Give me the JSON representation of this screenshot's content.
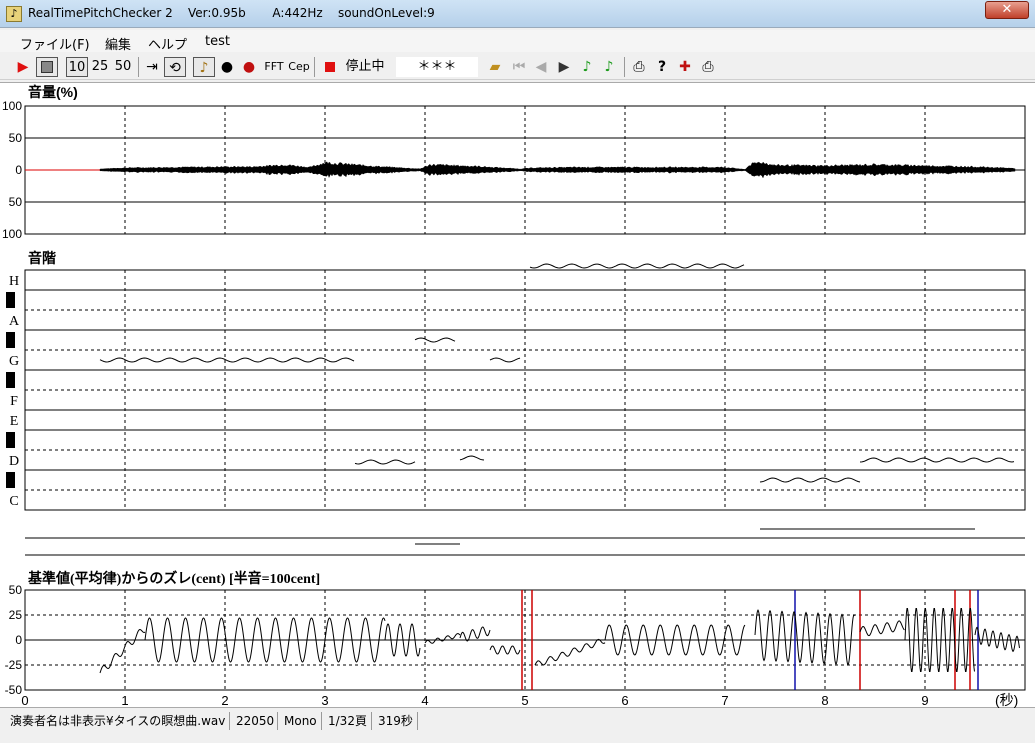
{
  "window": {
    "title": "RealTimePitchChecker 2    Ver:0.95b       A:442Hz    soundOnLevel:9",
    "close_label": "✕"
  },
  "menu": [
    "ファイル(F)",
    "編集",
    "ヘルプ",
    "test"
  ],
  "toolbar": {
    "play_icon": "play-icon",
    "stop_icon": "stop-icon",
    "zoom_options": [
      "10",
      "25",
      "50"
    ],
    "fft_label": "FFT",
    "cep_label": "Cep",
    "status_text": "停止中",
    "display_text": "＊＊＊",
    "colors": {
      "play": "#e01010",
      "stop_state": "#e01010",
      "note_green": "#1a9a1a"
    }
  },
  "panels": {
    "volume": {
      "title": "音量(%)",
      "yticks": [
        "100",
        "50",
        "0",
        "50",
        "100"
      ]
    },
    "scale": {
      "title": "音階",
      "notes": [
        "H",
        "A",
        "G",
        "F",
        "E",
        "D",
        "C"
      ]
    },
    "cents": {
      "title": "基準値(平均律)からのズレ(cent) [半音=100cent]",
      "yticks": [
        "50",
        "25",
        "0",
        "-25",
        "-50"
      ]
    }
  },
  "chart_data": {
    "type": "line",
    "x_axis": {
      "ticks": [
        "0",
        "1",
        "2",
        "3",
        "4",
        "5",
        "6",
        "7",
        "8",
        "9"
      ],
      "unit_label": "(秒)",
      "xlim": [
        0,
        10
      ]
    },
    "volume": {
      "type": "area",
      "ylim": [
        -100,
        100
      ],
      "x": [
        0.75,
        1.0,
        1.5,
        2.0,
        2.3,
        2.6,
        2.85,
        3.0,
        3.5,
        3.95,
        4.05,
        4.5,
        4.95,
        5.1,
        5.5,
        6.0,
        6.5,
        7.0,
        7.2,
        7.25,
        7.35,
        7.5,
        8.0,
        8.5,
        9.0,
        9.5,
        9.9
      ],
      "amplitude": [
        2,
        4,
        5,
        6,
        6,
        10,
        5,
        14,
        7,
        2,
        10,
        7,
        2,
        4,
        5,
        5,
        5,
        5,
        1,
        10,
        15,
        9,
        8,
        10,
        8,
        6,
        3
      ]
    },
    "pitch_segments": [
      {
        "x": [
          0.75,
          3.3
        ],
        "note_level": 7.5
      },
      {
        "x": [
          3.3,
          3.9
        ],
        "note_level": 2.4
      },
      {
        "x": [
          3.9,
          4.3
        ],
        "note_level": 8.5
      },
      {
        "x": [
          4.35,
          4.6
        ],
        "note_level": 2.6
      },
      {
        "x": [
          4.65,
          4.95
        ],
        "note_level": 7.5
      },
      {
        "x": [
          5.05,
          7.2
        ],
        "note_level": 12.2
      },
      {
        "x": [
          7.35,
          8.35
        ],
        "note_level": 1.5
      },
      {
        "x": [
          8.35,
          9.9
        ],
        "note_level": 2.5
      }
    ],
    "cents": {
      "ylim": [
        -50,
        50
      ],
      "segments": [
        {
          "x_start": 0.75,
          "x_end": 1.2,
          "y_start": -33,
          "y_end": 12,
          "amp": 4,
          "period": 0.12
        },
        {
          "x_start": 1.2,
          "x_end": 3.6,
          "y_start": 0,
          "y_end": 0,
          "amp": 22,
          "period": 0.18
        },
        {
          "x_start": 3.6,
          "x_end": 3.95,
          "y_start": 0,
          "y_end": 0,
          "amp": 16,
          "period": 0.12
        },
        {
          "x_start": 4.0,
          "x_end": 4.35,
          "y_start": -3,
          "y_end": 5,
          "amp": 2,
          "period": 0.1
        },
        {
          "x_start": 4.35,
          "x_end": 4.65,
          "y_start": 2,
          "y_end": 10,
          "amp": 5,
          "period": 0.1
        },
        {
          "x_start": 4.65,
          "x_end": 4.95,
          "y_start": -10,
          "y_end": -10,
          "amp": 4,
          "period": 0.1
        },
        {
          "x_start": 5.1,
          "x_end": 5.8,
          "y_start": -25,
          "y_end": 0,
          "amp": 3,
          "period": 0.12
        },
        {
          "x_start": 5.8,
          "x_end": 7.2,
          "y_start": 0,
          "y_end": 0,
          "amp": 15,
          "period": 0.17
        },
        {
          "x_start": 7.3,
          "x_end": 8.3,
          "y_start": 5,
          "y_end": 0,
          "amp": 25,
          "period": 0.12
        },
        {
          "x_start": 8.35,
          "x_end": 8.8,
          "y_start": 8,
          "y_end": 15,
          "amp": 5,
          "period": 0.12
        },
        {
          "x_start": 8.8,
          "x_end": 9.5,
          "y_start": 0,
          "y_end": 0,
          "amp": 32,
          "period": 0.09
        },
        {
          "x_start": 9.5,
          "x_end": 9.95,
          "y_start": 5,
          "y_end": -5,
          "amp": 8,
          "period": 0.08
        }
      ],
      "markers": [
        {
          "x": 4.97,
          "color": "#cc0000"
        },
        {
          "x": 5.07,
          "color": "#cc0000"
        },
        {
          "x": 8.35,
          "color": "#cc0000"
        },
        {
          "x": 9.3,
          "color": "#cc0000"
        },
        {
          "x": 9.45,
          "color": "#cc0000"
        },
        {
          "x": 7.7,
          "color": "#1010aa"
        },
        {
          "x": 9.53,
          "color": "#1010aa"
        }
      ]
    }
  },
  "statusbar": {
    "cells": [
      "演奏者名は非表示¥タイスの瞑想曲.wav",
      "22050",
      "Mono",
      "1/32頁",
      "319秒"
    ]
  }
}
